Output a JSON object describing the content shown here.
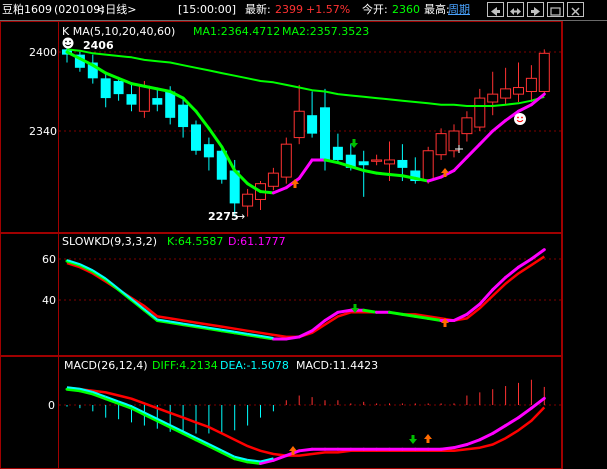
{
  "topbar": {
    "symbol": "豆粕1609",
    "code": "(020109)",
    "period": "<日线>",
    "time": "[15:00:00]",
    "latest_label": "最新:",
    "latest_value": "2399",
    "change": "+1.57%",
    "open_label": "今开:",
    "open_value": "2360",
    "high_label": "最高:",
    "cycle_label": "周期"
  },
  "colors": {
    "up": "#ff3232",
    "down": "#00ffff",
    "ma_green": "#00ff00",
    "kd_k": "#00ff00",
    "kd_d": "#ff00ff",
    "text": "#ffffff",
    "panel_border": "#a00000",
    "grid": "#800000",
    "magenta": "#ff00ff"
  },
  "main_panel": {
    "title": "K  MA(5,10,20,40,60)",
    "ma1_label": "MA1:2364.4712",
    "ma2_label": "MA2:2357.3523",
    "y_ticks": [
      "2400",
      "2340"
    ],
    "max_label": "2406",
    "min_label": "2275"
  },
  "kd_panel": {
    "title": "SLOWKD(9,3,3,2)",
    "k_label": "K:64.5587",
    "d_label": "D:61.1777",
    "y_ticks": [
      "60",
      "40"
    ]
  },
  "macd_panel": {
    "title": "MACD(26,12,4)",
    "diff_label": "DIFF:4.2134",
    "dea_label": "DEA:-1.5078",
    "macd_label": "MACD:11.4423",
    "y_ticks": [
      "0"
    ]
  },
  "chart_data": {
    "type": "candlestick",
    "candles": [
      {
        "o": 2402,
        "h": 2406,
        "l": 2392,
        "c": 2398
      },
      {
        "o": 2398,
        "h": 2400,
        "l": 2385,
        "c": 2388
      },
      {
        "o": 2392,
        "h": 2398,
        "l": 2376,
        "c": 2380
      },
      {
        "o": 2380,
        "h": 2385,
        "l": 2358,
        "c": 2365
      },
      {
        "o": 2378,
        "h": 2380,
        "l": 2363,
        "c": 2368
      },
      {
        "o": 2368,
        "h": 2376,
        "l": 2355,
        "c": 2360
      },
      {
        "o": 2355,
        "h": 2378,
        "l": 2350,
        "c": 2374
      },
      {
        "o": 2365,
        "h": 2372,
        "l": 2355,
        "c": 2360
      },
      {
        "o": 2370,
        "h": 2374,
        "l": 2345,
        "c": 2350
      },
      {
        "o": 2360,
        "h": 2365,
        "l": 2335,
        "c": 2343
      },
      {
        "o": 2345,
        "h": 2348,
        "l": 2322,
        "c": 2325
      },
      {
        "o": 2330,
        "h": 2335,
        "l": 2310,
        "c": 2320
      },
      {
        "o": 2325,
        "h": 2328,
        "l": 2300,
        "c": 2303
      },
      {
        "o": 2310,
        "h": 2318,
        "l": 2275,
        "c": 2285
      },
      {
        "o": 2283,
        "h": 2296,
        "l": 2275,
        "c": 2292
      },
      {
        "o": 2288,
        "h": 2302,
        "l": 2280,
        "c": 2300
      },
      {
        "o": 2298,
        "h": 2312,
        "l": 2295,
        "c": 2308
      },
      {
        "o": 2305,
        "h": 2335,
        "l": 2300,
        "c": 2330
      },
      {
        "o": 2335,
        "h": 2375,
        "l": 2330,
        "c": 2355
      },
      {
        "o": 2352,
        "h": 2370,
        "l": 2335,
        "c": 2338
      },
      {
        "o": 2358,
        "h": 2372,
        "l": 2310,
        "c": 2318
      },
      {
        "o": 2328,
        "h": 2338,
        "l": 2315,
        "c": 2318
      },
      {
        "o": 2322,
        "h": 2330,
        "l": 2310,
        "c": 2312
      },
      {
        "o": 2317,
        "h": 2325,
        "l": 2290,
        "c": 2314
      },
      {
        "o": 2317,
        "h": 2322,
        "l": 2314,
        "c": 2318
      },
      {
        "o": 2315,
        "h": 2332,
        "l": 2302,
        "c": 2318
      },
      {
        "o": 2318,
        "h": 2330,
        "l": 2302,
        "c": 2312
      },
      {
        "o": 2310,
        "h": 2320,
        "l": 2300,
        "c": 2302
      },
      {
        "o": 2303,
        "h": 2328,
        "l": 2300,
        "c": 2325
      },
      {
        "o": 2322,
        "h": 2342,
        "l": 2318,
        "c": 2338
      },
      {
        "o": 2325,
        "h": 2345,
        "l": 2320,
        "c": 2340
      },
      {
        "o": 2338,
        "h": 2355,
        "l": 2332,
        "c": 2350
      },
      {
        "o": 2343,
        "h": 2372,
        "l": 2340,
        "c": 2365
      },
      {
        "o": 2362,
        "h": 2385,
        "l": 2352,
        "c": 2368
      },
      {
        "o": 2365,
        "h": 2388,
        "l": 2360,
        "c": 2372
      },
      {
        "o": 2368,
        "h": 2392,
        "l": 2362,
        "c": 2373
      },
      {
        "o": 2370,
        "h": 2390,
        "l": 2362,
        "c": 2380
      },
      {
        "o": 2370,
        "h": 2402,
        "l": 2368,
        "c": 2399
      }
    ],
    "ma_green": [
      2402,
      2401,
      2399,
      2398,
      2397,
      2396,
      2394,
      2393,
      2392,
      2390,
      2388,
      2386,
      2384,
      2382,
      2380,
      2378,
      2377,
      2375,
      2373,
      2371,
      2370,
      2368,
      2367,
      2366,
      2365,
      2364,
      2363,
      2362,
      2361,
      2360,
      2360,
      2359,
      2359,
      2359,
      2360,
      2361,
      2363,
      2366
    ],
    "ma_fast": [
      2400,
      2395,
      2390,
      2384,
      2380,
      2376,
      2374,
      2372,
      2370,
      2365,
      2355,
      2342,
      2328,
      2310,
      2300,
      2294,
      2293,
      2297,
      2304,
      2318,
      2318,
      2316,
      2313,
      2310,
      2308,
      2307,
      2306,
      2304,
      2302,
      2305,
      2310,
      2320,
      2330,
      2340,
      2348,
      2355,
      2360,
      2368
    ],
    "slowkd": {
      "k": [
        59,
        57,
        54,
        50,
        45,
        40,
        35,
        30,
        29,
        28,
        27,
        26,
        25,
        24,
        23,
        22,
        21,
        21,
        22,
        25,
        30,
        34,
        35,
        35,
        34,
        34,
        33,
        32,
        31,
        30,
        30,
        33,
        38,
        45,
        51,
        56,
        60,
        64.56
      ],
      "d": [
        58,
        56,
        53,
        49,
        45,
        41,
        37,
        32,
        31,
        30,
        29,
        28,
        27,
        26,
        25,
        24,
        23,
        22,
        22,
        24,
        28,
        32,
        34,
        34,
        34,
        34,
        33,
        33,
        32,
        31,
        30,
        31,
        36,
        42,
        48,
        53,
        57,
        61.18
      ]
    },
    "macd": {
      "diff": [
        10,
        9,
        7,
        4,
        1,
        -2,
        -6,
        -10,
        -14,
        -18,
        -22,
        -26,
        -30,
        -34,
        -36,
        -37,
        -35,
        -32,
        -29,
        -28,
        -28,
        -28,
        -28,
        -28,
        -28,
        -28,
        -28,
        -28,
        -28,
        -28,
        -27,
        -25,
        -22,
        -18,
        -13,
        -8,
        -2,
        4.21
      ],
      "dea": [
        11,
        10,
        9,
        8,
        6,
        4,
        1,
        -2,
        -5,
        -8,
        -11,
        -14,
        -18,
        -22,
        -26,
        -29,
        -31,
        -32,
        -32,
        -31,
        -30,
        -30,
        -29,
        -29,
        -29,
        -29,
        -29,
        -29,
        -29,
        -29,
        -29,
        -28,
        -27,
        -25,
        -21,
        -16,
        -10,
        -1.51
      ],
      "bar": [
        -1,
        -2,
        -4,
        -8,
        -9,
        -11,
        -13,
        -15,
        -17,
        -18,
        -18,
        -18,
        -18,
        -16,
        -13,
        -8,
        -4,
        3,
        6,
        5,
        3,
        3,
        1,
        2,
        1,
        1,
        1,
        1,
        1,
        1,
        1,
        6,
        8,
        10,
        12,
        14,
        16,
        11.44
      ]
    }
  }
}
